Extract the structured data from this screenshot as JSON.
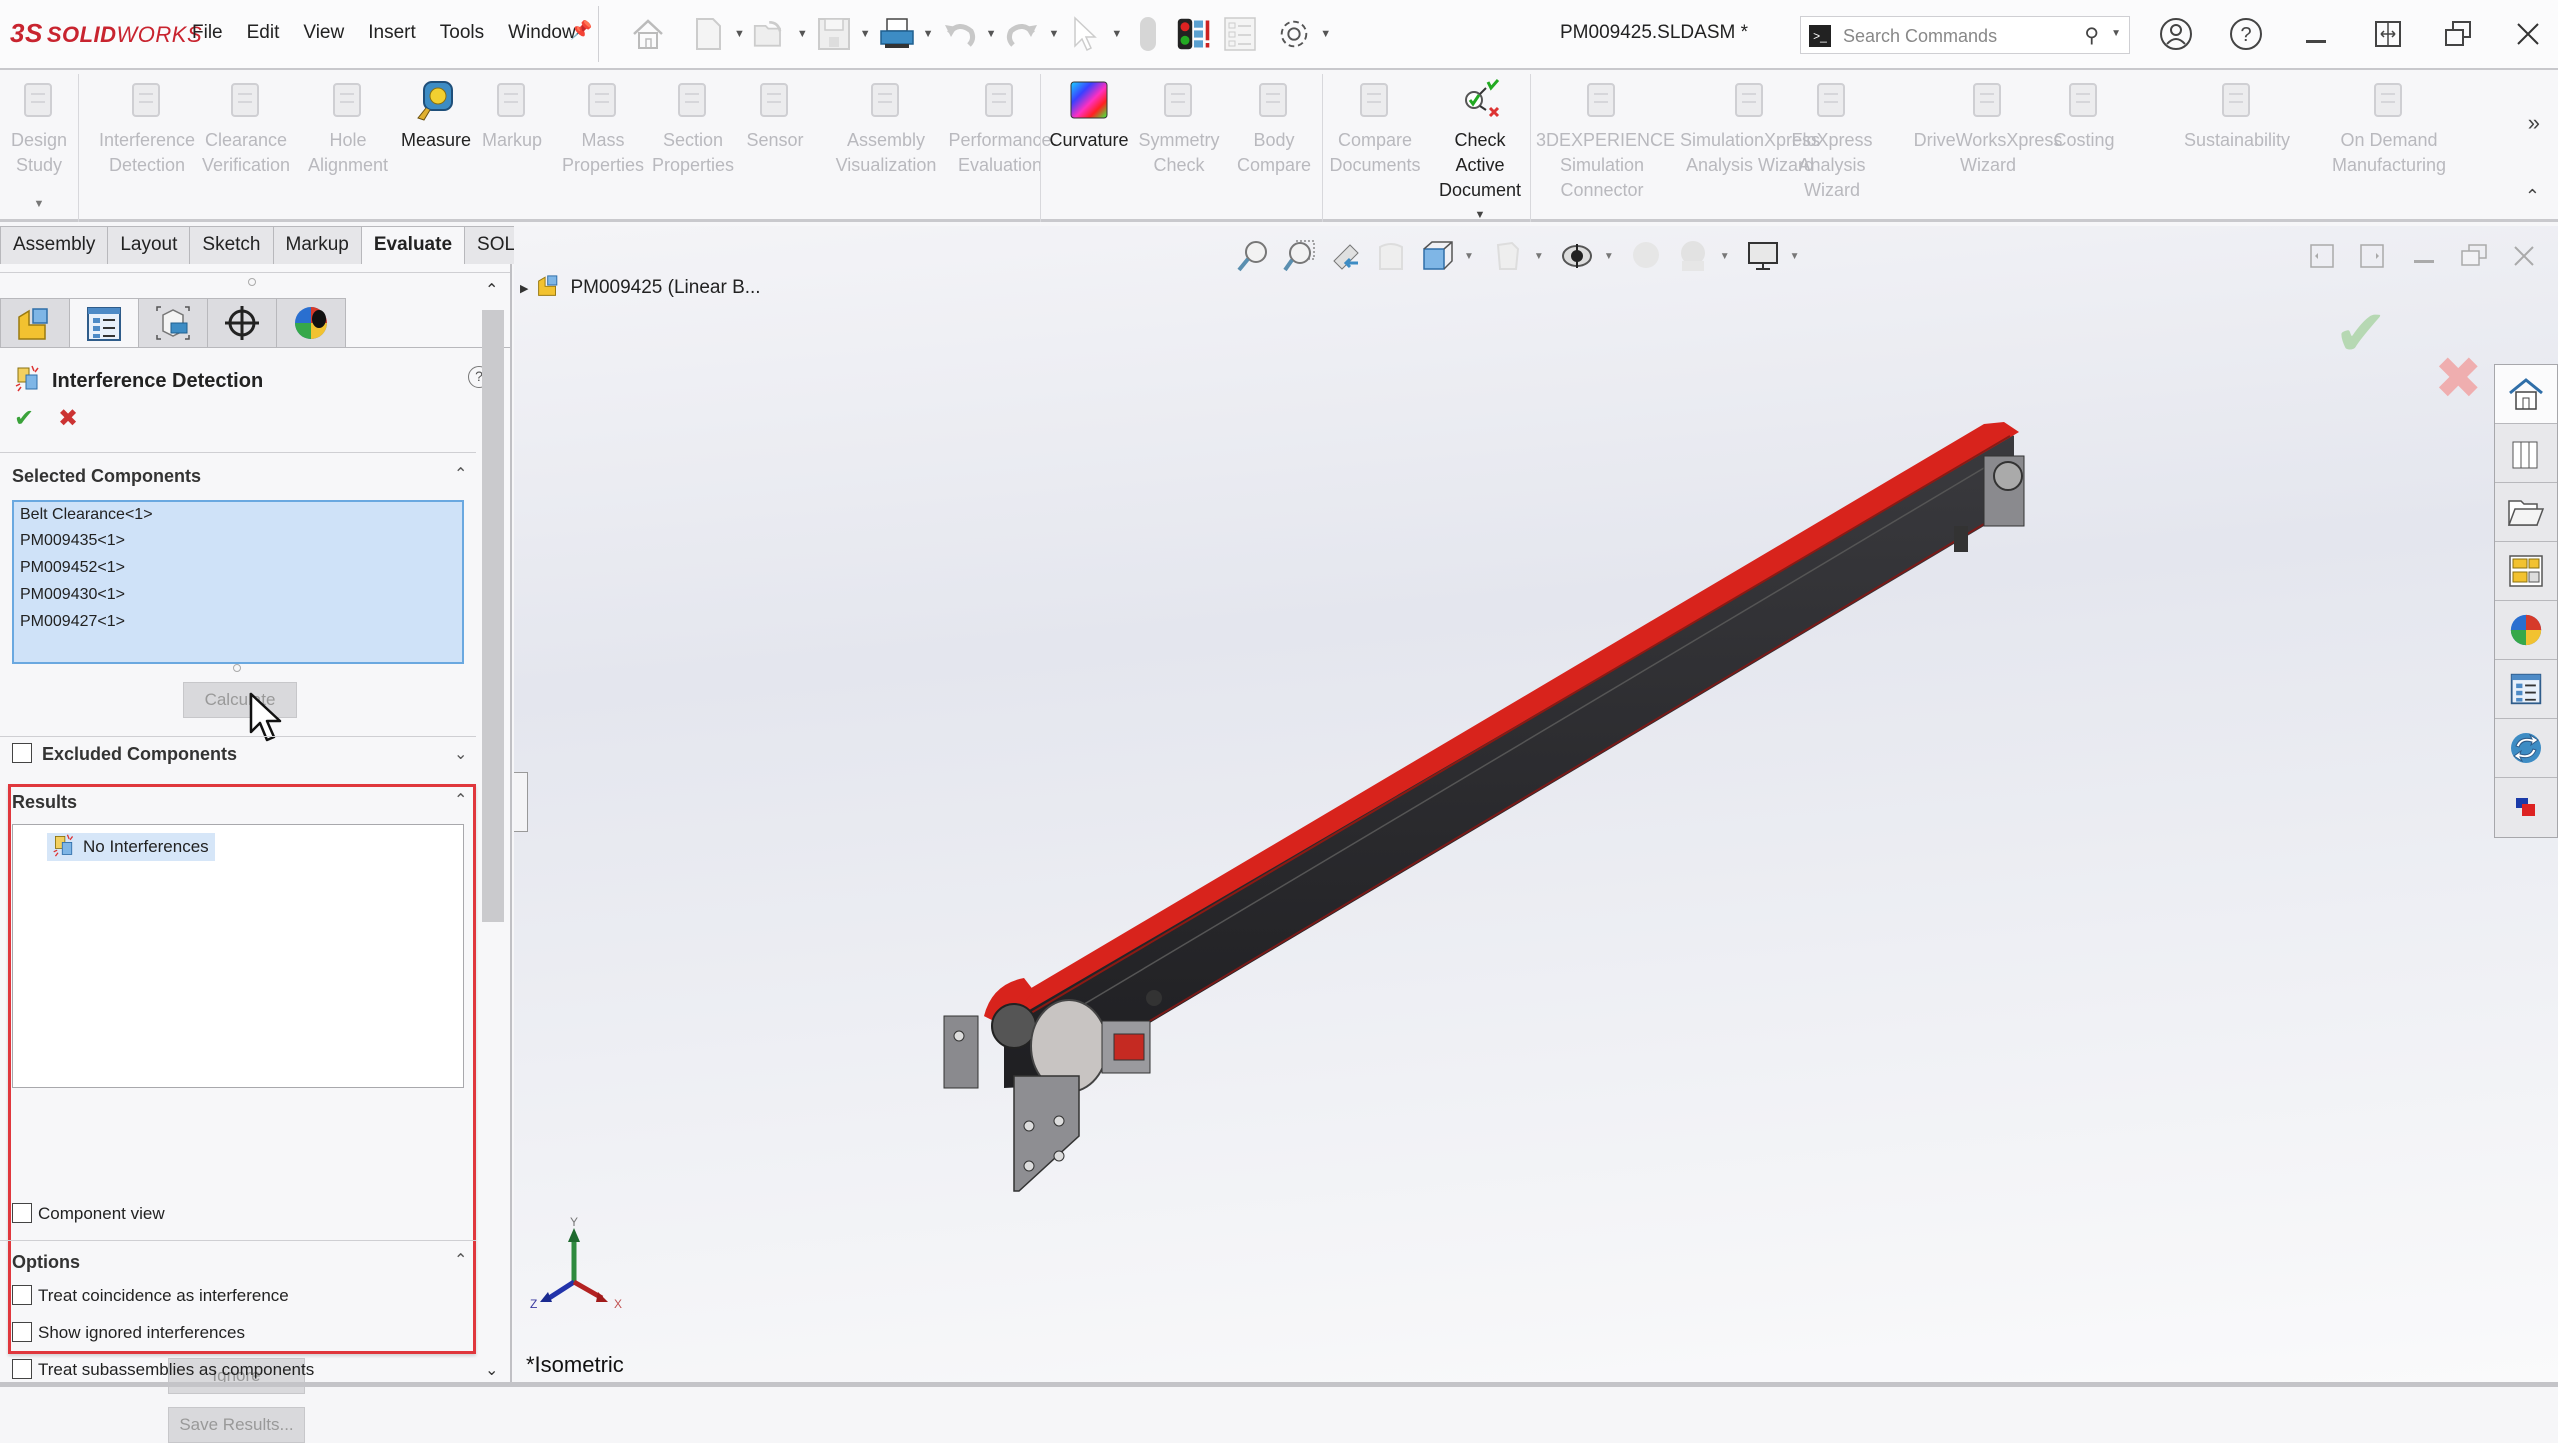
{
  "app": {
    "brand_prefix": "3S",
    "brand_bold": "SOLID",
    "brand_rest": "WORKS",
    "document_title": "PM009425.SLDASM *"
  },
  "menu": [
    "File",
    "Edit",
    "View",
    "Insert",
    "Tools",
    "Window"
  ],
  "search": {
    "placeholder": "Search Commands"
  },
  "ribbon": {
    "items": [
      {
        "label": "Design\nStudy",
        "icon": "design-study-icon",
        "enabled": false
      },
      {
        "label": "Interference\nDetection",
        "icon": "interference-detection-icon",
        "enabled": false
      },
      {
        "label": "Clearance\nVerification",
        "icon": "clearance-verification-icon",
        "enabled": false
      },
      {
        "label": "Hole\nAlignment",
        "icon": "hole-alignment-icon",
        "enabled": false
      },
      {
        "label": "Measure",
        "icon": "measure-icon",
        "enabled": true
      },
      {
        "label": "Markup",
        "icon": "markup-icon",
        "enabled": false
      },
      {
        "label": "Mass\nProperties",
        "icon": "mass-properties-icon",
        "enabled": false
      },
      {
        "label": "Section\nProperties",
        "icon": "section-properties-icon",
        "enabled": false
      },
      {
        "label": "Sensor",
        "icon": "sensor-icon",
        "enabled": false
      },
      {
        "label": "Assembly\nVisualization",
        "icon": "assembly-visualization-icon",
        "enabled": false
      },
      {
        "label": "Performance\nEvaluation",
        "icon": "performance-evaluation-icon",
        "enabled": false
      },
      {
        "label": "Curvature",
        "icon": "curvature-icon",
        "enabled": true
      },
      {
        "label": "Symmetry\nCheck",
        "icon": "symmetry-check-icon",
        "enabled": false
      },
      {
        "label": "Body\nCompare",
        "icon": "body-compare-icon",
        "enabled": false
      },
      {
        "label": "Compare\nDocuments",
        "icon": "compare-documents-icon",
        "enabled": false
      },
      {
        "label": "Check\nActive\nDocument",
        "icon": "check-active-document-icon",
        "enabled": true
      },
      {
        "label": "3DEXPERIENCE\nSimulation\nConnector",
        "icon": "simulation-connector-icon",
        "enabled": false
      },
      {
        "label": "SimulationXpress\nAnalysis Wizard",
        "icon": "simulationxpress-icon",
        "enabled": false
      },
      {
        "label": "FloXpress\nAnalysis\nWizard",
        "icon": "floxpress-icon",
        "enabled": false
      },
      {
        "label": "DriveWorksXpress\nWizard",
        "icon": "driveworksxpress-icon",
        "enabled": false
      },
      {
        "label": "Costing",
        "icon": "costing-icon",
        "enabled": false
      },
      {
        "label": "Sustainability",
        "icon": "sustainability-icon",
        "enabled": false
      },
      {
        "label": "On Demand\nManufacturing",
        "icon": "on-demand-manufacturing-icon",
        "enabled": false
      }
    ]
  },
  "command_tabs": [
    {
      "label": "Assembly",
      "active": false
    },
    {
      "label": "Layout",
      "active": false
    },
    {
      "label": "Sketch",
      "active": false
    },
    {
      "label": "Markup",
      "active": false
    },
    {
      "label": "Evaluate",
      "active": true
    },
    {
      "label": "SOLIDWORKS Add-Ins",
      "active": false
    }
  ],
  "property_manager": {
    "title": "Interference Detection",
    "selected_components": {
      "header": "Selected Components",
      "items": [
        "Belt Clearance<1>",
        "PM009435<1>",
        "PM009452<1>",
        "PM009430<1>",
        "PM009427<1>"
      ]
    },
    "calculate_label": "Calculate",
    "excluded_components": {
      "header": "Excluded Components",
      "checked": false
    },
    "results": {
      "header": "Results",
      "items": [
        "No Interferences"
      ]
    },
    "ignore_label": "Ignore",
    "save_results_label": "Save Results...",
    "component_view": {
      "label": "Component view",
      "checked": false
    },
    "options": {
      "header": "Options",
      "items": [
        {
          "label": "Treat coincidence as interference",
          "checked": false
        },
        {
          "label": "Show ignored interferences",
          "checked": false
        },
        {
          "label": "Treat subassemblies as components",
          "checked": false
        }
      ]
    }
  },
  "viewport": {
    "tree_root": "PM009425 (Linear B...",
    "view_orientation": "*Isometric",
    "triad": {
      "x": "X",
      "y": "Y",
      "z": "Z"
    }
  },
  "colors": {
    "brand_red": "#c8242f",
    "belt_red": "#d8231c",
    "frame_dark": "#2b2b2e",
    "highlight_red": "#e0373d",
    "selection_blue": "#cfe2f8"
  }
}
